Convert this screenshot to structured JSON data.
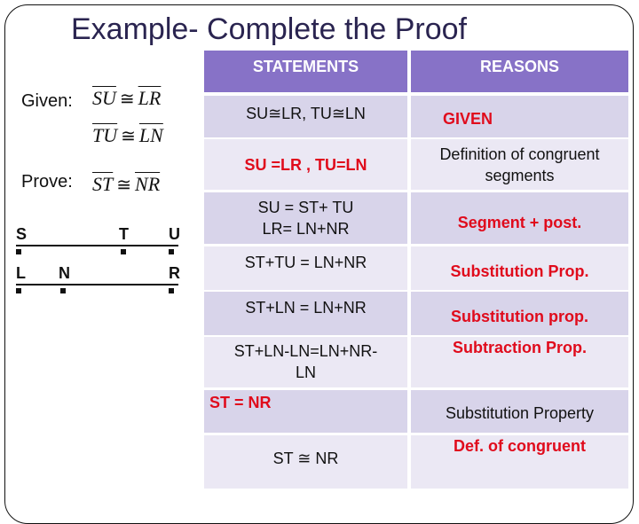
{
  "title": "Example- Complete the Proof",
  "given": {
    "label": "Given:",
    "statements": [
      {
        "left": "SU",
        "symbol": "≅",
        "right": "LR"
      },
      {
        "left": "TU",
        "symbol": "≅",
        "right": "LN"
      }
    ]
  },
  "prove": {
    "label": "Prove:",
    "statement": {
      "left": "ST",
      "symbol": "≅",
      "right": "NR"
    }
  },
  "diagram": {
    "top_segment": {
      "points": [
        "S",
        "T",
        "U"
      ]
    },
    "bottom_segment": {
      "points": [
        "L",
        "N",
        "R"
      ]
    }
  },
  "table": {
    "headers": {
      "statements": "STATEMENTS",
      "reasons": "REASONS"
    },
    "rows": [
      {
        "statement": "SU≅LR, TU≅LN",
        "statement_style": "normal",
        "reason": "GIVEN",
        "reason_style": "red"
      },
      {
        "statement": "SU =LR , TU=LN",
        "statement_style": "red",
        "reason": "Definition of congruent segments",
        "reason_style": "normal"
      },
      {
        "statement": "SU = ST+ TU\nLR= LN+NR",
        "statement_style": "normal",
        "reason": "Segment + post.",
        "reason_style": "red"
      },
      {
        "statement": "ST+TU = LN+NR",
        "statement_style": "normal",
        "reason": "Substitution Prop.",
        "reason_style": "red"
      },
      {
        "statement": "ST+LN = LN+NR",
        "statement_style": "normal",
        "reason": "Substitution prop.",
        "reason_style": "red"
      },
      {
        "statement": "ST+LN-LN=LN+NR-\nLN",
        "statement_style": "normal",
        "reason": "Subtraction Prop.",
        "reason_style": "red"
      },
      {
        "statement": "ST = NR",
        "statement_style": "red",
        "reason": "Substitution Property",
        "reason_style": "normal"
      },
      {
        "statement": "ST ≅ NR",
        "statement_style": "normal",
        "reason": "Def. of congruent",
        "reason_style": "red"
      }
    ]
  },
  "colors": {
    "title": "#2a2450",
    "header_bg": "#8772c7",
    "row_dark": "#d8d4ea",
    "row_light": "#ebe8f4",
    "answer_red": "#e00b1c"
  }
}
